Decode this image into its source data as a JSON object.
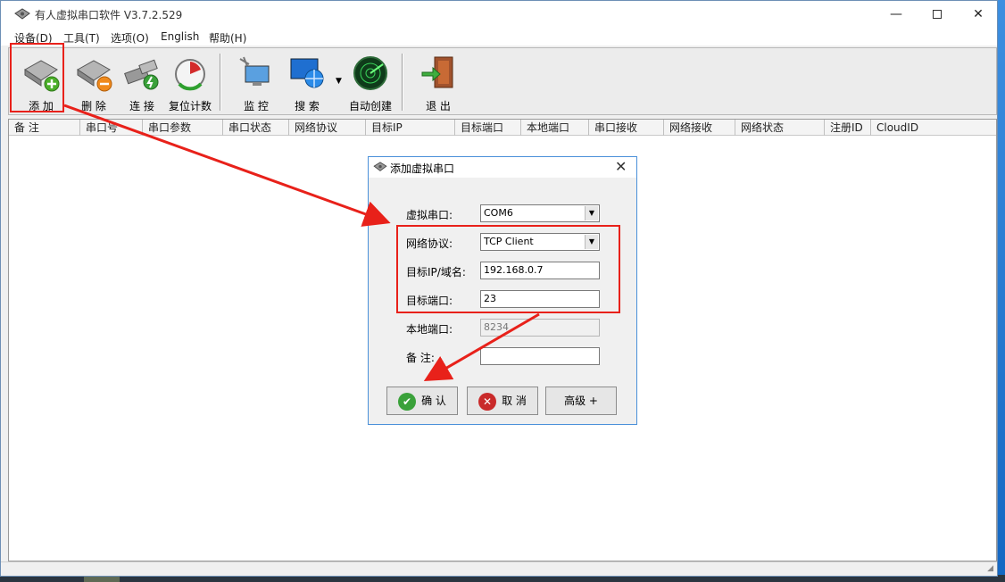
{
  "window": {
    "title": "有人虚拟串口软件 V3.7.2.529"
  },
  "menu": [
    "设备(D)",
    "工具(T)",
    "选项(O)",
    "English",
    "帮助(H)"
  ],
  "toolbar": {
    "add": "添 加",
    "delete": "删 除",
    "connect": "连 接",
    "reset": "复位计数",
    "monitor": "监 控",
    "search": "搜 索",
    "autocreate": "自动创建",
    "exit": "退 出"
  },
  "columns": [
    "备 注",
    "串口号",
    "串口参数",
    "串口状态",
    "网络协议",
    "目标IP",
    "目标端口",
    "本地端口",
    "串口接收",
    "网络接收",
    "网络状态",
    "注册ID",
    "CloudID"
  ],
  "dialog": {
    "title": "添加虚拟串口",
    "com_label": "虚拟串口:",
    "com_value": "COM6",
    "protocol_label": "网络协议:",
    "protocol_value": "TCP Client",
    "ip_label": "目标IP/域名:",
    "ip_value": "192.168.0.7",
    "port_label": "目标端口:",
    "port_value": "23",
    "local_port_label": "本地端口:",
    "local_port_value": "8234",
    "note_label": "备 注:",
    "note_value": "",
    "ok_label": "确 认",
    "cancel_label": "取 消",
    "advanced_label": "高级 +"
  },
  "colors": {
    "annotation": "#e8211a",
    "accent": "#4a90d9"
  }
}
